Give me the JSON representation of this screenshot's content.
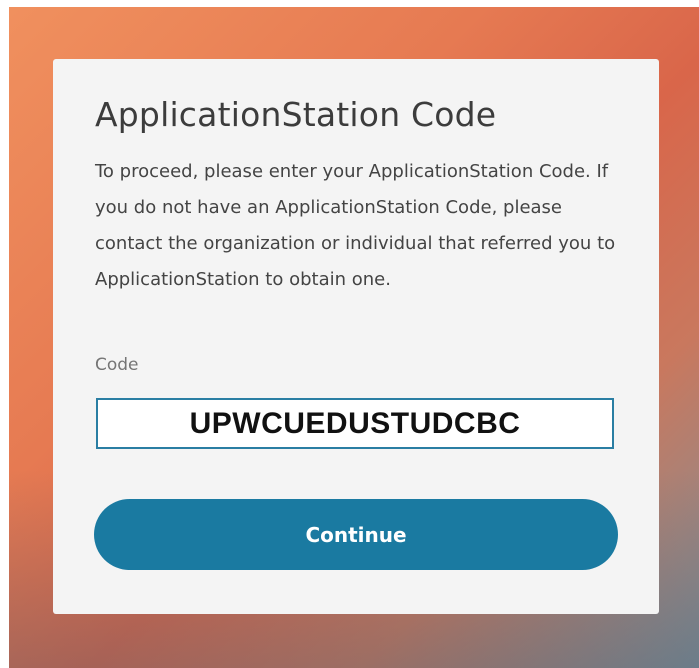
{
  "dialog": {
    "title": "ApplicationStation Code",
    "description": "To proceed, please enter your ApplicationStation Code. If you do not have an ApplicationStation Code, please contact the organization or individual that referred you to ApplicationStation to obtain one.",
    "code_label": "Code",
    "code_value": "UPWCUEDUSTUDCBC",
    "continue_label": "Continue"
  },
  "colors": {
    "card_background": "#f4f4f4",
    "button": "#1a7aa1",
    "input_border": "#2a7ea3"
  }
}
